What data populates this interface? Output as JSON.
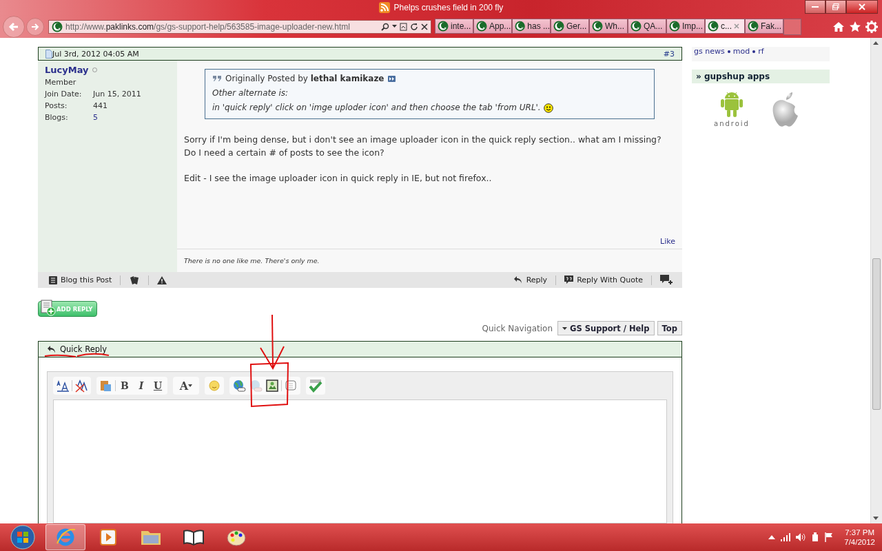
{
  "browser": {
    "title": "Phelps crushes field in 200 fly",
    "address_prefix": "http://www.",
    "address_domain": "paklinks.com",
    "address_path": "/gs/gs-support-help/563585-image-uploader-new.html",
    "tabs": [
      {
        "label": "inte...",
        "selected": false
      },
      {
        "label": "App...",
        "selected": false
      },
      {
        "label": "has ...",
        "selected": false
      },
      {
        "label": "Ger...",
        "selected": false
      },
      {
        "label": "Wh...",
        "selected": false
      },
      {
        "label": "QA...",
        "selected": false
      },
      {
        "label": "Imp...",
        "selected": false
      },
      {
        "label": "c...",
        "selected": true
      },
      {
        "label": "Fak...",
        "selected": false
      }
    ]
  },
  "post": {
    "date": "Jul 3rd, 2012 04:05 AM",
    "number": "#3",
    "author": "LucyMay",
    "rank": "Member",
    "stats": [
      {
        "label": "Join Date:",
        "value": "Jun 15, 2011",
        "kind": "text"
      },
      {
        "label": "Posts:",
        "value": "441",
        "kind": "text"
      },
      {
        "label": "Blogs:",
        "value": "5",
        "kind": "link"
      }
    ],
    "quote": {
      "prefix": "Originally Posted by",
      "author": "lethal kamikaze",
      "lines": [
        "Other alternate is:",
        "in 'quick reply' click on 'imge uploder icon' and then choose the tab 'from URL'."
      ]
    },
    "paragraphs": [
      "Sorry if I'm being dense, but i don't see an image uploader icon in the quick reply section.. what am I missing? Do I need a certain # of posts to see the icon?",
      "Edit - I see the image uploader icon in quick reply in IE, but not firefox.."
    ],
    "like": "Like",
    "signature": "There is no one like me. There's only me.",
    "blog_action": "Blog this Post",
    "reply_action": "Reply",
    "quote_action": "Reply With Quote"
  },
  "add_reply": "ADD REPLY",
  "quick_navigation": {
    "label": "Quick Navigation",
    "menu": "GS Support / Help",
    "top": "Top"
  },
  "quick_reply": {
    "title": "Quick Reply",
    "format_buttons": [
      "B",
      "I",
      "U"
    ],
    "font_button": "A"
  },
  "sidebar": {
    "links": [
      "gs news",
      "mod",
      "rf"
    ],
    "apps_title": "» gupshup apps",
    "android_label": "android"
  },
  "taskbar": {
    "time": "7:37 PM",
    "date": "7/4/2012"
  }
}
